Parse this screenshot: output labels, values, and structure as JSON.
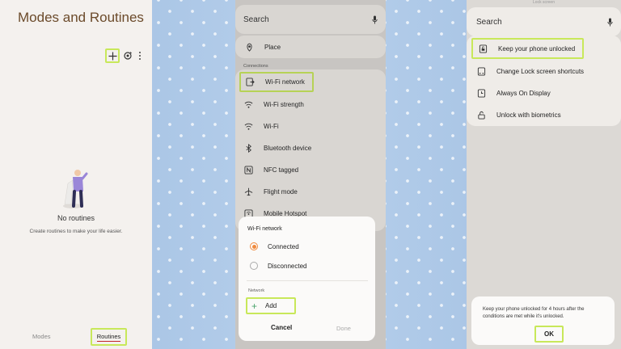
{
  "routines_screen": {
    "title": "Modes and Routines",
    "empty_title": "No routines",
    "empty_subtitle": "Create routines to make your life easier.",
    "tabs": {
      "modes": "Modes",
      "routines": "Routines"
    }
  },
  "conditions_screen": {
    "search_label": "Search",
    "place": "Place",
    "section_label": "Connections",
    "items": [
      "Wi-Fi network",
      "Wi-Fi strength",
      "Wi-Fi",
      "Bluetooth device",
      "NFC tagged",
      "Flight mode",
      "Mobile Hotspot"
    ],
    "dialog": {
      "title": "Wi-Fi network",
      "options": [
        "Connected",
        "Disconnected"
      ],
      "selected_option": "Connected",
      "network_label": "Network",
      "add_label": "Add",
      "cancel_label": "Cancel",
      "done_label": "Done"
    }
  },
  "actions_screen": {
    "peek_text": "Lock screen",
    "search_label": "Search",
    "items": [
      "Keep your phone unlocked",
      "Change Lock screen shortcuts",
      "Always On Display",
      "Unlock with biometrics"
    ],
    "toast_message": "Keep your phone unlocked for 4 hours after the conditions are met while it's unlocked.",
    "ok_label": "OK"
  },
  "colors": {
    "highlight": "#c8e85a",
    "accent_orange": "#f08a3d",
    "title_brown": "#6b4a2a",
    "tab_underline": "#c2282c"
  }
}
